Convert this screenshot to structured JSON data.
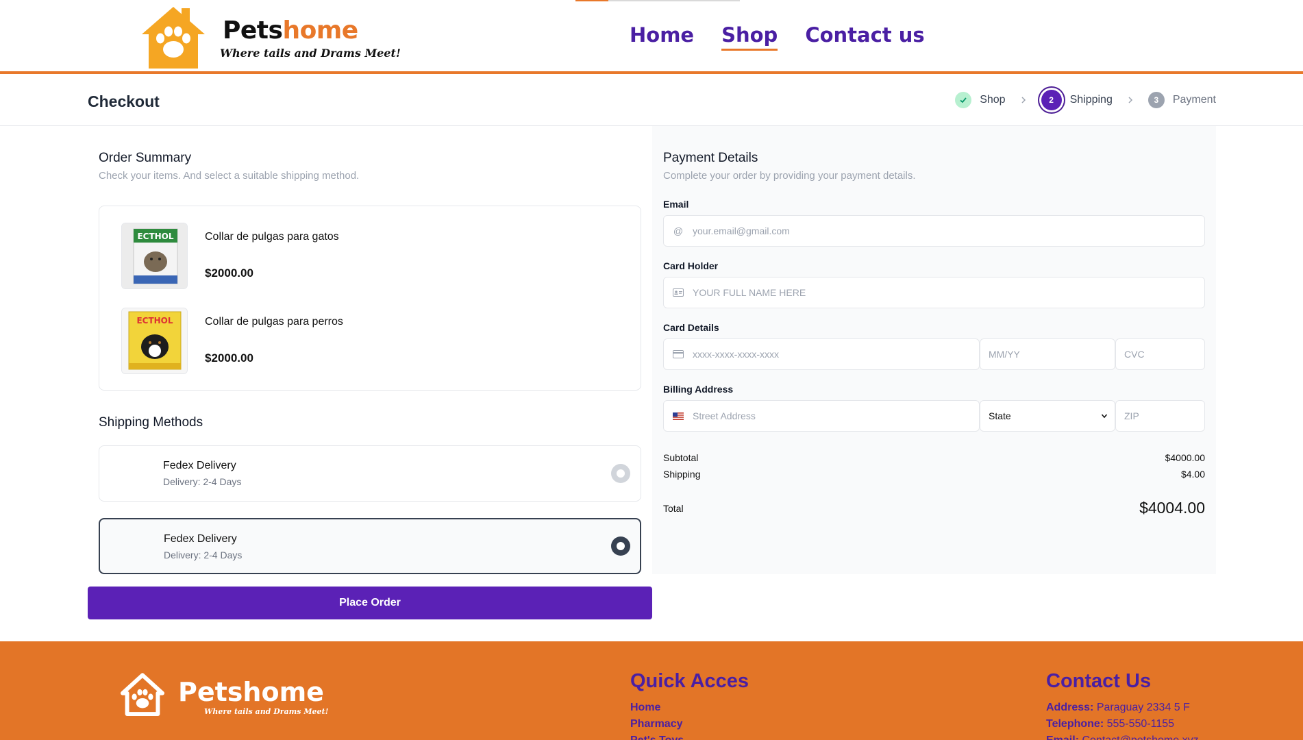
{
  "header": {
    "brand_first": "Pets",
    "brand_second": "home",
    "tagline": "Where tails and Drams Meet!",
    "nav": [
      {
        "label": "Home",
        "active": false
      },
      {
        "label": "Shop",
        "active": true
      },
      {
        "label": "Contact us",
        "active": false
      }
    ]
  },
  "checkout": {
    "title": "Checkout",
    "steps": [
      {
        "label": "Shop",
        "state": "done"
      },
      {
        "label": "Shipping",
        "number": "2",
        "state": "current"
      },
      {
        "label": "Payment",
        "number": "3",
        "state": "todo"
      }
    ]
  },
  "order_summary": {
    "title": "Order Summary",
    "subtitle": "Check your items. And select a suitable shipping method.",
    "items": [
      {
        "name": "Collar de pulgas para gatos",
        "price": "$2000.00",
        "thumb_brand": "ECTHOL"
      },
      {
        "name": "Collar de pulgas para perros",
        "price": "$2000.00",
        "thumb_brand": "ECTHOL"
      }
    ]
  },
  "shipping": {
    "title": "Shipping Methods",
    "options": [
      {
        "name": "Fedex Delivery",
        "eta": "Delivery: 2-4 Days",
        "selected": false
      },
      {
        "name": "Fedex Delivery",
        "eta": "Delivery: 2-4 Days",
        "selected": true
      }
    ]
  },
  "place_order_label": "Place Order",
  "payment": {
    "title": "Payment Details",
    "subtitle": "Complete your order by providing your payment details.",
    "email_label": "Email",
    "email_placeholder": "your.email@gmail.com",
    "holder_label": "Card Holder",
    "holder_placeholder": "YOUR FULL NAME HERE",
    "card_label": "Card Details",
    "card_placeholder": "xxxx-xxxx-xxxx-xxxx",
    "expiry_placeholder": "MM/YY",
    "cvc_placeholder": "CVC",
    "billing_label": "Billing Address",
    "street_placeholder": "Street Address",
    "state_value": "State",
    "zip_placeholder": "ZIP"
  },
  "totals": {
    "subtotal_label": "Subtotal",
    "subtotal": "$4000.00",
    "shipping_label": "Shipping",
    "shipping": "$4.00",
    "total_label": "Total",
    "total": "$4004.00"
  },
  "footer": {
    "brand": "Petshome",
    "tagline": "Where tails and Drams Meet!",
    "quick_title": "Quick Acces",
    "quick_links": [
      "Home",
      "Pharmacy",
      "Pet's Toys"
    ],
    "contact_title": "Contact Us",
    "address_label": "Address:",
    "address": "Paraguay 2334 5 F",
    "phone_label": "Telephone:",
    "phone": "555-550-1155",
    "email_label": "Email:",
    "email": "Contact@petshome.xyz"
  },
  "colors": {
    "brand_orange": "#e8782a",
    "brand_purple": "#5b21b6",
    "nav_purple": "#4a1fa3",
    "footer_bg": "#e37527"
  }
}
